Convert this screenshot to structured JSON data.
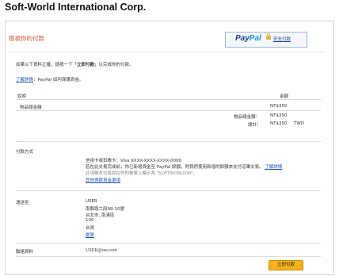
{
  "site_title": "Soft-World International Corp.",
  "header": {
    "title": "檢視你的付款",
    "paypal_logo_pay": "Pay",
    "paypal_logo_pal": "Pal",
    "secure_label": "安全付款"
  },
  "intro": {
    "text_before": "如果以下資料正確，請按一下「",
    "text_bold": "立即付款",
    "text_after": "」以完成你的付款。",
    "learn_more": "了解詳情",
    "learn_more_suffix": "：PayPal 如何保護資金。"
  },
  "summary": {
    "col_description": "說明",
    "col_amount": "金額",
    "item_label": "物品總金額",
    "item_amount": "NT$350",
    "subtotal_label": "物品總金額：",
    "subtotal_amount": "NT$350",
    "total_label": "總計：",
    "total_amount": "NT$350",
    "currency": "TWD"
  },
  "payment": {
    "label": "付款方式",
    "card": "信用卡或扣帳卡：Visa XXXX-XXXX-XXXX-0000",
    "line2": "若在此交易完成前，你已新增資金至 PayPal 餘額，則我們使用新增的餘額來支付這筆交易。",
    "line2_link": "了解詳情",
    "line3": "此項帳本交易將在你的帳單上顯示為 \"SOFTWORLDIN\"。",
    "other_link": "其他得款資金選項"
  },
  "shipping": {
    "label": "運送至",
    "lines": [
      "USER",
      "南縣路二段99-10號",
      "台北市, 南港區",
      "100",
      "台灣"
    ],
    "change_link": "變更"
  },
  "contact": {
    "label": "聯絡資料",
    "email": "USER@usr.com"
  },
  "pay_button": "立即付款"
}
